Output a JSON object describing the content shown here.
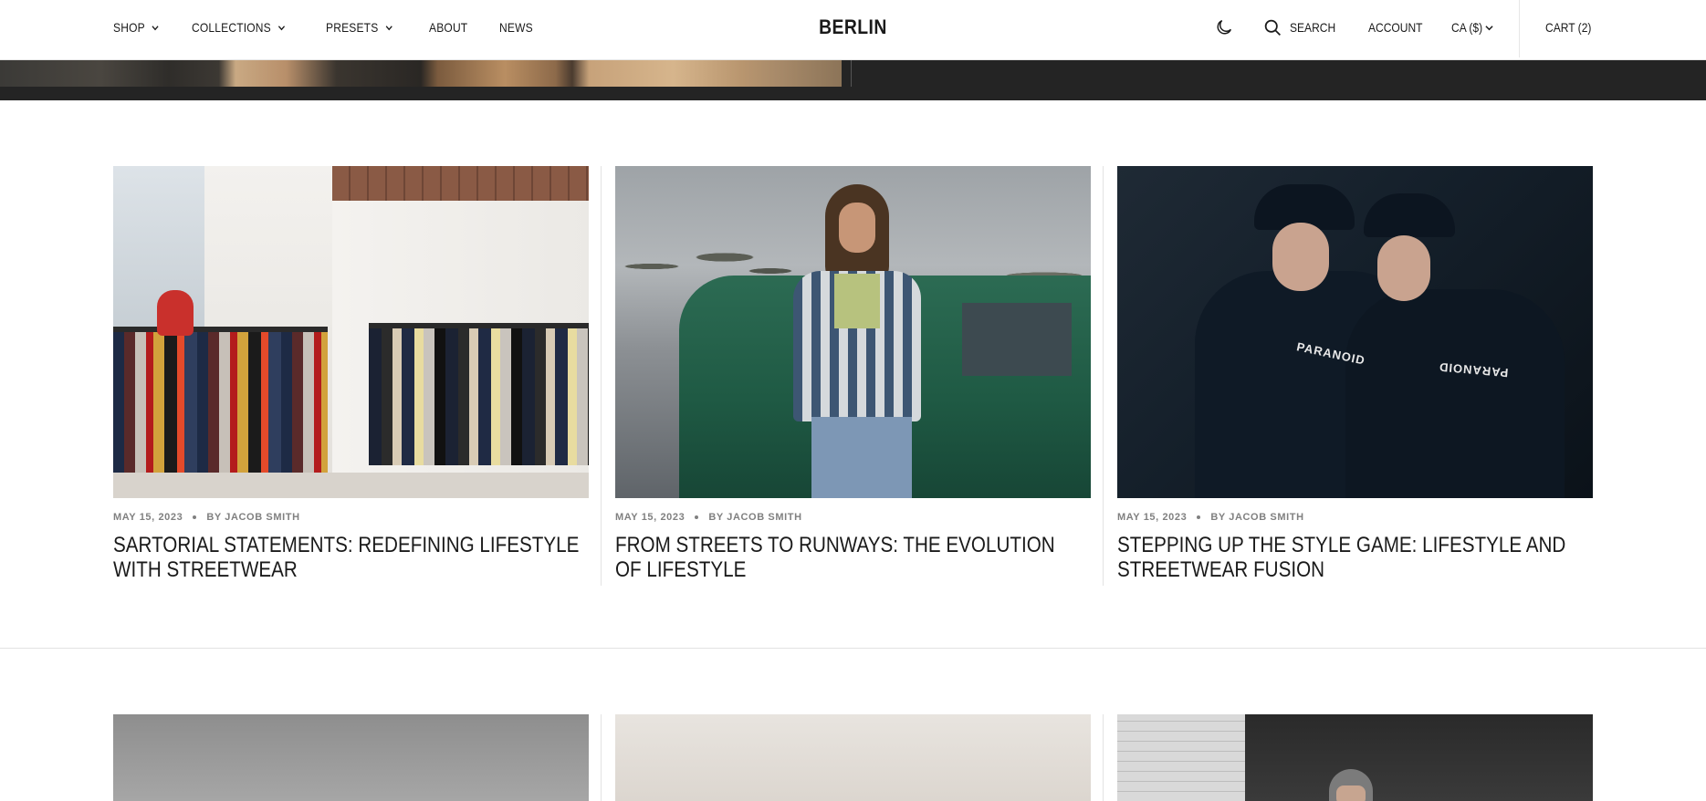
{
  "header": {
    "nav": [
      {
        "label": "SHOP",
        "has_dropdown": true
      },
      {
        "label": "COLLECTIONS",
        "has_dropdown": true
      },
      {
        "label": "PRESETS",
        "has_dropdown": true
      },
      {
        "label": "ABOUT",
        "has_dropdown": false
      },
      {
        "label": "NEWS",
        "has_dropdown": false
      }
    ],
    "brand": "BERLIN",
    "theme_icon": "moon-icon",
    "search_label": "SEARCH",
    "account_label": "ACCOUNT",
    "currency_label": "CA ($)",
    "cart_label": "CART (2)"
  },
  "articles": [
    {
      "date": "MAY 15, 2023",
      "author": "BY JACOB SMITH",
      "title": "SARTORIAL STATEMENTS: REDEFINING LIFESTYLE WITH STREETWEAR"
    },
    {
      "date": "MAY 15, 2023",
      "author": "BY JACOB SMITH",
      "title": "FROM STREETS TO RUNWAYS: THE EVOLUTION OF LIFESTYLE"
    },
    {
      "date": "MAY 15, 2023",
      "author": "BY JACOB SMITH",
      "title": "STEPPING UP THE STYLE GAME: LIFESTYLE AND STREETWEAR FUSION"
    }
  ],
  "hoodie_prints": [
    "PARANOID",
    "PARANOID"
  ],
  "colors": {
    "text": "#1a1a1a",
    "meta": "#808080",
    "hero_strip": "#242424",
    "divider": "#e3e3e3"
  }
}
